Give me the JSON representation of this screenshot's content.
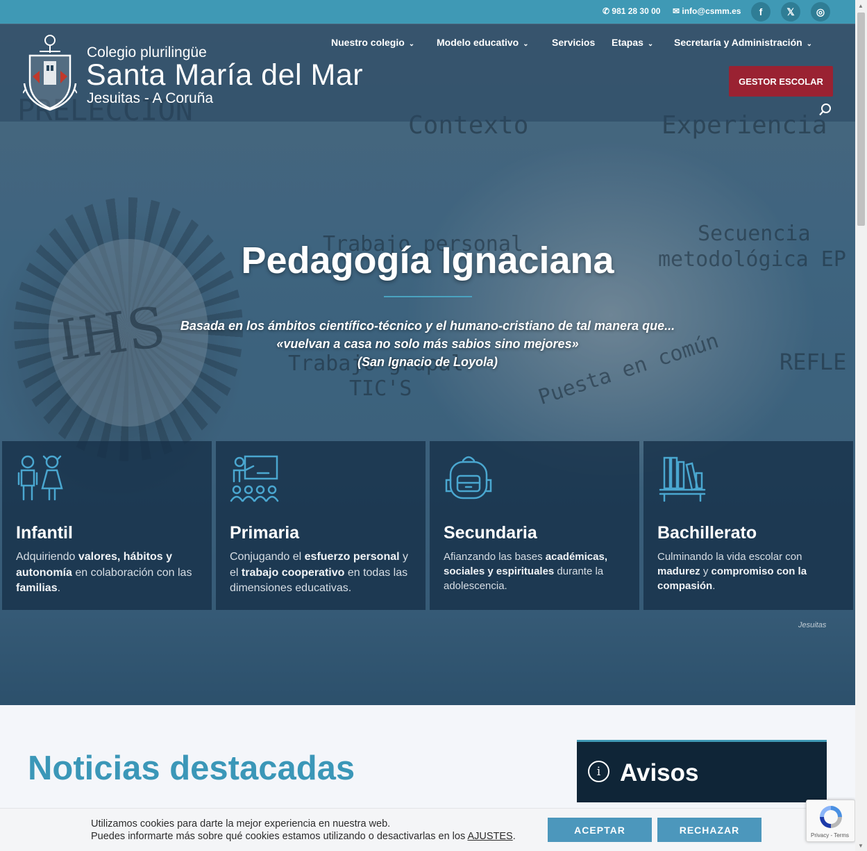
{
  "topbar": {
    "phone": "981 28 30 00",
    "email": "info@csmm.es",
    "social": [
      {
        "icon": "facebook-icon",
        "glyph": "f"
      },
      {
        "icon": "x-icon",
        "glyph": "𝕏"
      },
      {
        "icon": "instagram-icon",
        "glyph": "◎"
      }
    ]
  },
  "logo": {
    "line1": "Colegio plurilingüe",
    "line2": "Santa María del Mar",
    "line3": "Jesuitas - A Coruña"
  },
  "nav": {
    "items": [
      {
        "label": "Nuestro colegio",
        "dropdown": true
      },
      {
        "label": "Modelo educativo",
        "dropdown": true
      },
      {
        "label": "Servicios",
        "dropdown": false
      },
      {
        "label": "Etapas",
        "dropdown": true
      },
      {
        "label": "Secretaría y Administración",
        "dropdown": true
      }
    ],
    "gestor_label": "GESTOR ESCOLAR"
  },
  "hero": {
    "title": "Pedagogía Ignaciana",
    "subtitle_line1": "Basada en los ámbitos científico-técnico y el humano-cristiano de tal manera que...",
    "subtitle_line2": "«vuelvan a casa no solo más sabios sino mejores»",
    "subtitle_line3": "(San Ignacio de Loyola)",
    "background_words": [
      "PRELECCION",
      "Contexto",
      "Experiencia",
      "Secuencia",
      "metodológica EP",
      "Trabajo personal",
      "Trabajo grupal",
      "TIC'S",
      "Puesta en común",
      "REFLE",
      "IHS"
    ],
    "watermark": "Jesuitas"
  },
  "cards": [
    {
      "icon": "children-icon",
      "title": "Infantil",
      "text": [
        {
          "t": "Adquiriendo ",
          "b": false
        },
        {
          "t": "valores, hábitos y autonomía",
          "b": true
        },
        {
          "t": " en colaboración con las ",
          "b": false
        },
        {
          "t": "familias",
          "b": true
        },
        {
          "t": ".",
          "b": false
        }
      ]
    },
    {
      "icon": "teacher-class-icon",
      "title": "Primaria",
      "text": [
        {
          "t": "Conjugando el ",
          "b": false
        },
        {
          "t": "esfuerzo personal",
          "b": true
        },
        {
          "t": " y el ",
          "b": false
        },
        {
          "t": "trabajo cooperativo",
          "b": true
        },
        {
          "t": " en todas las dimensiones educativas.",
          "b": false
        }
      ]
    },
    {
      "icon": "backpack-icon",
      "title": "Secundaria",
      "text": [
        {
          "t": "Afianzando las bases ",
          "b": false
        },
        {
          "t": "académicas, sociales y espirituales",
          "b": true
        },
        {
          "t": " durante la adolescencia.",
          "b": false
        }
      ]
    },
    {
      "icon": "bookshelf-icon",
      "title": "Bachillerato",
      "text": [
        {
          "t": "Culminando la vida escolar con ",
          "b": false
        },
        {
          "t": "madurez",
          "b": true
        },
        {
          "t": " y ",
          "b": false
        },
        {
          "t": "compromiso con la compasión",
          "b": true
        },
        {
          "t": ".",
          "b": false
        }
      ]
    }
  ],
  "news": {
    "title_bold": "Noticias",
    "title_rest": " destacadas"
  },
  "avisos": {
    "label": "Avisos",
    "info_glyph": "i"
  },
  "cookies": {
    "line1": "Utilizamos cookies para darte la mejor experiencia en nuestra web.",
    "line2_prefix": "Puedes informarte más sobre qué cookies estamos utilizando o desactivarlas en los ",
    "line2_link": "AJUSTES",
    "line2_suffix": ".",
    "accept": "ACEPTAR",
    "reject": "RECHAZAR"
  },
  "recaptcha": {
    "privacy": "Privacy",
    "sep": " - ",
    "terms": "Terms"
  },
  "colors": {
    "topbar": "#3f99b5",
    "gestor": "#9a2232",
    "accent": "#3b97b8",
    "avisos_bg": "#0f2537",
    "cookie_btn": "#4c97bc"
  }
}
